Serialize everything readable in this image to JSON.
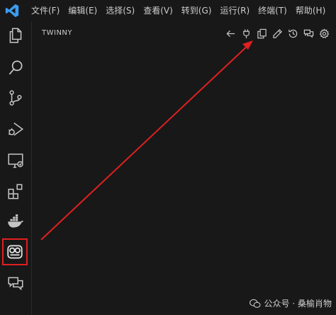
{
  "menu": {
    "items": [
      "文件(F)",
      "编辑(E)",
      "选择(S)",
      "查看(V)",
      "转到(G)",
      "运行(R)",
      "终端(T)",
      "帮助(H)"
    ]
  },
  "activity_bar": {
    "items": [
      {
        "icon": "explorer-icon"
      },
      {
        "icon": "search-icon"
      },
      {
        "icon": "source-control-icon"
      },
      {
        "icon": "run-debug-icon"
      },
      {
        "icon": "remote-explorer-icon"
      },
      {
        "icon": "extensions-icon"
      },
      {
        "icon": "docker-icon"
      },
      {
        "icon": "twinny-icon",
        "selected": true
      },
      {
        "icon": "chat-icon"
      }
    ]
  },
  "sidebar": {
    "title": "TWINNY",
    "toolbar": [
      "back-arrow-icon",
      "plug-icon",
      "copy-icon",
      "pencil-icon",
      "history-icon",
      "chat-icon",
      "settings-gear-icon"
    ]
  },
  "watermark": {
    "text": "公众号 · 桑榆肖物"
  },
  "colors": {
    "background": "#181818",
    "accent_blue": "#3b9cf0",
    "annotation_red": "#e02020",
    "icon_gray": "#c5c5c5"
  }
}
